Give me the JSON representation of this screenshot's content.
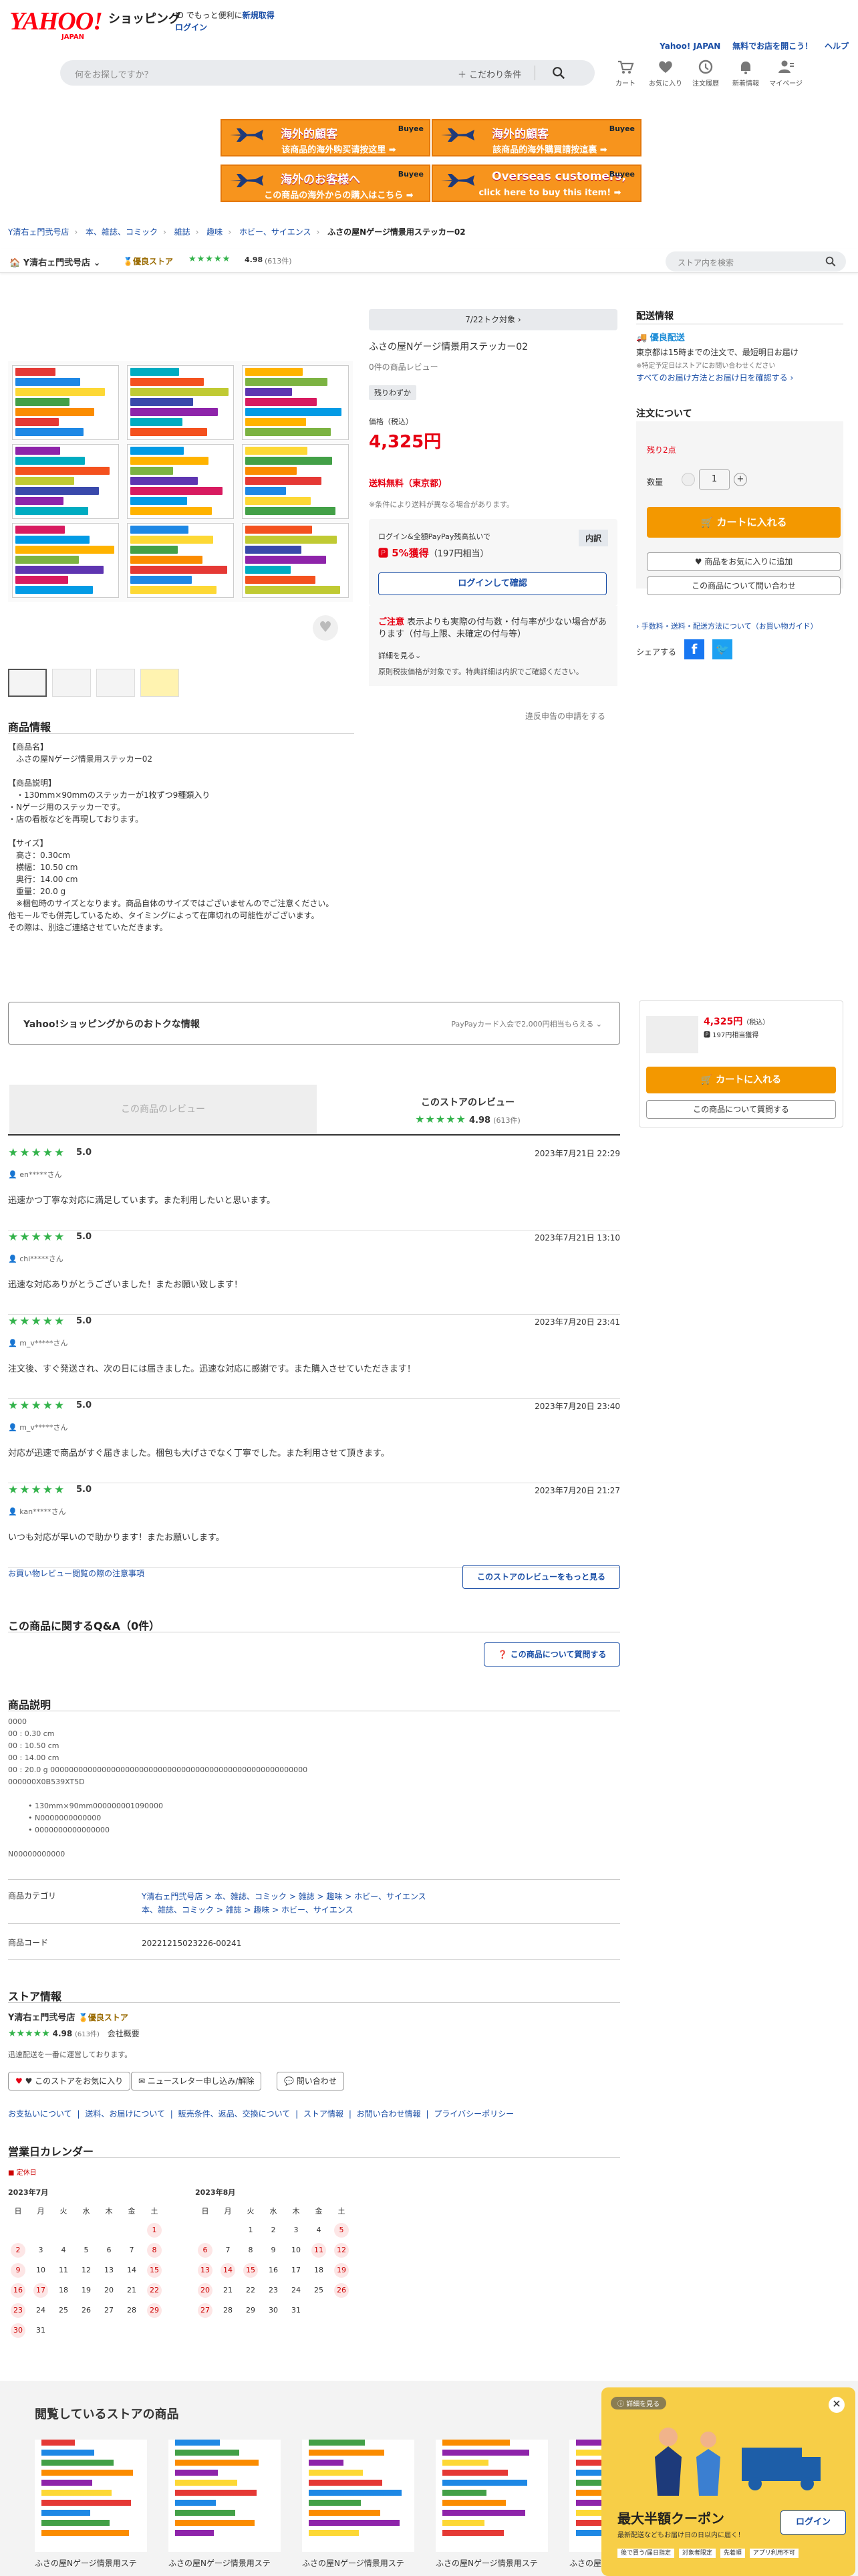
{
  "header": {
    "logo": "YAHOO!",
    "logo_sub": "JAPAN",
    "shop_title": "ショッピング",
    "promo_text": "ID でもっと便利に",
    "promo_link": "新規取得",
    "login": "ログイン",
    "right_links": [
      "Yahoo! JAPAN",
      "無料でお店を開こう！",
      "ヘルプ"
    ],
    "search_placeholder": "何をお探しですか？",
    "advanced_search": "こだわり条件",
    "icons": [
      {
        "name": "cart-icon",
        "label": "カート"
      },
      {
        "name": "favorite-icon",
        "label": "お気に入り"
      },
      {
        "name": "history-icon",
        "label": "注文履歴"
      },
      {
        "name": "bell-icon",
        "label": "新着情報"
      },
      {
        "name": "user-icon",
        "label": "マイページ"
      }
    ]
  },
  "banners": [
    {
      "t1": "海外的顧客",
      "t2": "该商品的海外购买请按这里 ➡",
      "brand": "Buyee"
    },
    {
      "t1": "海外的顧客",
      "t2": "該商品的海外購買請按這裏 ➡",
      "brand": "Buyee"
    },
    {
      "t1": "海外のお客様へ",
      "t2": "この商品の海外からの購入はこちら ➡",
      "brand": "Buyee"
    },
    {
      "t1": "Overseas customers,",
      "t2": "click here to buy this item! ➡",
      "brand": "Buyee"
    }
  ],
  "breadcrumb": [
    "Y清右ェ門弐号店",
    "本、雑誌、コミック",
    "雑誌",
    "趣味",
    "ホビー、サイエンス",
    "ふさの屋Nゲージ情景用ステッカー02"
  ],
  "store": {
    "name": "Y清右ェ門弐号店",
    "badge": "優良ストア",
    "stars": "★★★★★",
    "rating": "4.98",
    "count": "(613件)",
    "search_placeholder": "ストア内を検索"
  },
  "product": {
    "toku_button": "7/22トク対象 ›",
    "name": "ふさの屋Nゲージ情景用ステッカー02",
    "review_link": "0件の商品レビュー",
    "stock_tag": "残りわずか",
    "price_label": "価格（税込）",
    "price": "4,325円",
    "shipping": "送料無料（東京都）",
    "shipping_note": "※条件により送料が異なる場合があります。",
    "pp_text": "ログイン&全額PayPay残高払いで",
    "pp_points": "5%獲得",
    "pp_points_sub": "（197円相当）",
    "pp_detail": "内訳",
    "pp_login": "ログインして確認",
    "caution_title": "ご注意",
    "caution_text": "表示よりも実際の付与数・付与率が少ない場合があります（付与上限、未確定の付与等）",
    "caution_more": "詳細を見る⌄",
    "caution_note": "原則税抜価格が対象です。特典詳細は内訳でご確認ください。",
    "report": "違反申告の申請をする"
  },
  "right": {
    "delivery_title": "配送情報",
    "delivery_badge": "優良配送",
    "delivery_lines": [
      "東京都は15時までの注文で、最短明日お届け",
      "※特定予定日はストアにお問い合わせください",
      "すべてのお届け方法とお届け日を確認する ›"
    ],
    "order_title": "注文について",
    "stock": "残り2点",
    "qty_label": "数量",
    "qty_value": "1",
    "cart": "カートに入れる",
    "favorite": "♥ 商品をお気に入りに追加",
    "inquiry": "この商品について問い合わせ",
    "links": "› 手数料・送料・配送方法について（お買い物ガイド）",
    "share": "シェアする",
    "mini_price": "4,325円",
    "mini_tax": "（税込）",
    "mini_points": "197円相当獲得",
    "mini_inquiry": "この商品について質問する"
  },
  "info": {
    "title": "商品情報",
    "body": "【商品名】\n　ふさの屋Nゲージ情景用ステッカー02\n\n【商品説明】\n　・130mm×90mmのステッカーが1枚ずつ9種類入り\n・Nゲージ用のステッカーです。\n・店の看板などを再現しております。\n\n【サイズ】\n　高さ：0.30cm\n　横幅：10.50 cm\n　奥行：14.00 cm\n　重量：20.0 g\n　※梱包時のサイズとなります。商品自体のサイズではございませんのでご注意ください。\n他モールでも併売しているため、タイミングによって在庫切れの可能性がございます。\nその際は、別途ご連絡させていただきます。"
  },
  "deals": {
    "title": "Yahoo!ショッピングからのおトクな情報",
    "sub": "PayPayカード入会で2,000円相当もらえる ⌄"
  },
  "reviews": {
    "tab_product": "この商品のレビュー",
    "tab_store": "このストアのレビュー",
    "store_stars": "★★★★★",
    "store_rating": "4.98",
    "store_count": "(613件)",
    "items": [
      {
        "stars": "★★★★★",
        "score": "5.0",
        "date": "2023年7月21日 22:29",
        "user": "en*****さん",
        "text": "迅速かつ丁寧な対応に満足しています。また利用したいと思います。"
      },
      {
        "stars": "★★★★★",
        "score": "5.0",
        "date": "2023年7月21日 13:10",
        "user": "chi*****さん",
        "text": "迅速な対応ありがとうございました！またお願い致します！"
      },
      {
        "stars": "★★★★★",
        "score": "5.0",
        "date": "2023年7月20日 23:41",
        "user": "m_v*****さん",
        "text": "注文後、すぐ発送され、次の日には届きました。迅速な対応に感謝です。また購入させていただきます！"
      },
      {
        "stars": "★★★★★",
        "score": "5.0",
        "date": "2023年7月20日 23:40",
        "user": "m_v*****さん",
        "text": "対応が迅速で商品がすぐ届きました。梱包も大げさでなく丁寧でした。また利用させて頂きます。"
      },
      {
        "stars": "★★★★★",
        "score": "5.0",
        "date": "2023年7月20日 21:27",
        "user": "kan*****さん",
        "text": "いつも対応が早いので助かります！またお願いします。"
      }
    ],
    "guide_link": "お買い物レビュー閲覧の際の注意事項",
    "more_button": "このストアのレビューをもっと見る"
  },
  "qa": {
    "title": "この商品に関するQ&A（0件）",
    "button": "この商品について質問する"
  },
  "desc": {
    "title": "商品説明",
    "lines": [
      "0000",
      "00 : 0.30 cm",
      "00 : 10.50 cm",
      "00 : 14.00 cm",
      "00 : 20.0 g 0000000000000000000000000000000000000000000000000000000",
      "000000X0B539XT5D",
      "",
      "• 130mm×90mm000000001090000",
      "• N0000000000000",
      "• 0000000000000000",
      "",
      "N00000000000"
    ]
  },
  "table": [
    {
      "k": "商品カテゴリ",
      "v1": "Y清右ェ門弐号店 > 本、雑誌、コミック > 雑誌 > 趣味 > ホビー、サイエンス",
      "v2": "本、雑誌、コミック > 雑誌 > 趣味 > ホビー、サイエンス"
    },
    {
      "k": "商品コード",
      "v1": "20221215023226-00241",
      "v2": ""
    }
  ],
  "store_info": {
    "title": "ストア情報",
    "name": "Y清右ェ門弐号店",
    "badge": "優良ストア",
    "stars": "★★★★★",
    "rating": "4.98",
    "count": "(613件)",
    "company": "会社概要",
    "tagline": "迅速配送を一番に運営しております。",
    "buttons": [
      "♥ このストアをお気に入り",
      "ニュースレター申し込み/解除",
      "問い合わせ"
    ],
    "links": [
      "お支払いについて",
      "送料、お届けについて",
      "販売条件、返品、交換について",
      "ストア情報",
      "お問い合わせ情報",
      "プライバシーポリシー"
    ]
  },
  "calendar": {
    "title": "営業日カレンダー",
    "legend": "定休日",
    "weekdays": [
      "日",
      "月",
      "火",
      "水",
      "木",
      "金",
      "土"
    ],
    "months": [
      {
        "label": "2023年7月",
        "start": 6,
        "days": 31,
        "holidays": [
          1,
          2,
          8,
          9,
          15,
          16,
          17,
          22,
          23,
          29,
          30
        ]
      },
      {
        "label": "2023年8月",
        "start": 2,
        "days": 31,
        "holidays": [
          5,
          6,
          11,
          12,
          13,
          14,
          15,
          19,
          20,
          26,
          27
        ]
      }
    ]
  },
  "bottom": {
    "title": "閲覧しているストアの商品",
    "products": [
      "ふさの屋Nゲージ情景用ステ",
      "ふさの屋Nゲージ情景用ステ",
      "ふさの屋Nゲージ情景用ステ",
      "ふさの屋Nゲージ情景用ステ",
      "ふさの屋Nゲージ情景用ステ"
    ],
    "coupon_badge": "詳細を見る",
    "coupon_title": "最大半額クーポン",
    "coupon_sub": "最新配送などもお届け日の日以内に届く！",
    "coupon_login": "ログイン",
    "coupon_tags": [
      "後で買う/届日指定",
      "対象者限定",
      "先着順",
      "アプリ利用不可"
    ]
  }
}
